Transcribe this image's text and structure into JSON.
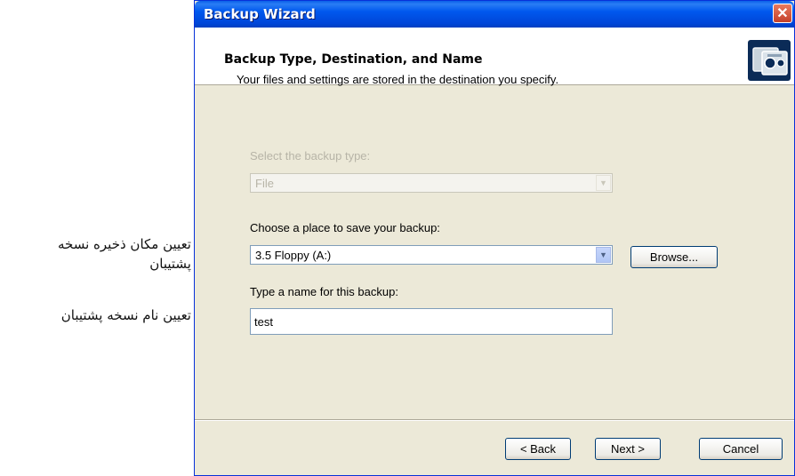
{
  "annotations": {
    "place_line1": "تعیین مکان ذخیره نسخه",
    "place_line2": "پشتیبان",
    "name": "تعیین نام نسخه پشتیبان"
  },
  "window": {
    "title": "Backup Wizard",
    "close_glyph": "✕"
  },
  "header": {
    "title": "Backup Type, Destination, and Name",
    "subtitle": "Your files and settings are stored in the destination you specify.",
    "icon": "backup-media-icon"
  },
  "form": {
    "type_label": "Select the backup type:",
    "type_value": "File",
    "place_label": "Choose a place to save your backup:",
    "place_value": "3.5 Floppy (A:)",
    "browse_label": "Browse...",
    "name_label": "Type a name for this backup:",
    "name_value": "test"
  },
  "footer": {
    "back_label": "< Back",
    "next_label": "Next >",
    "cancel_label": "Cancel"
  },
  "colors": {
    "title_bar": "#0058ee",
    "dialog_bg": "#ece9d8",
    "header_bg": "#ffffff"
  }
}
